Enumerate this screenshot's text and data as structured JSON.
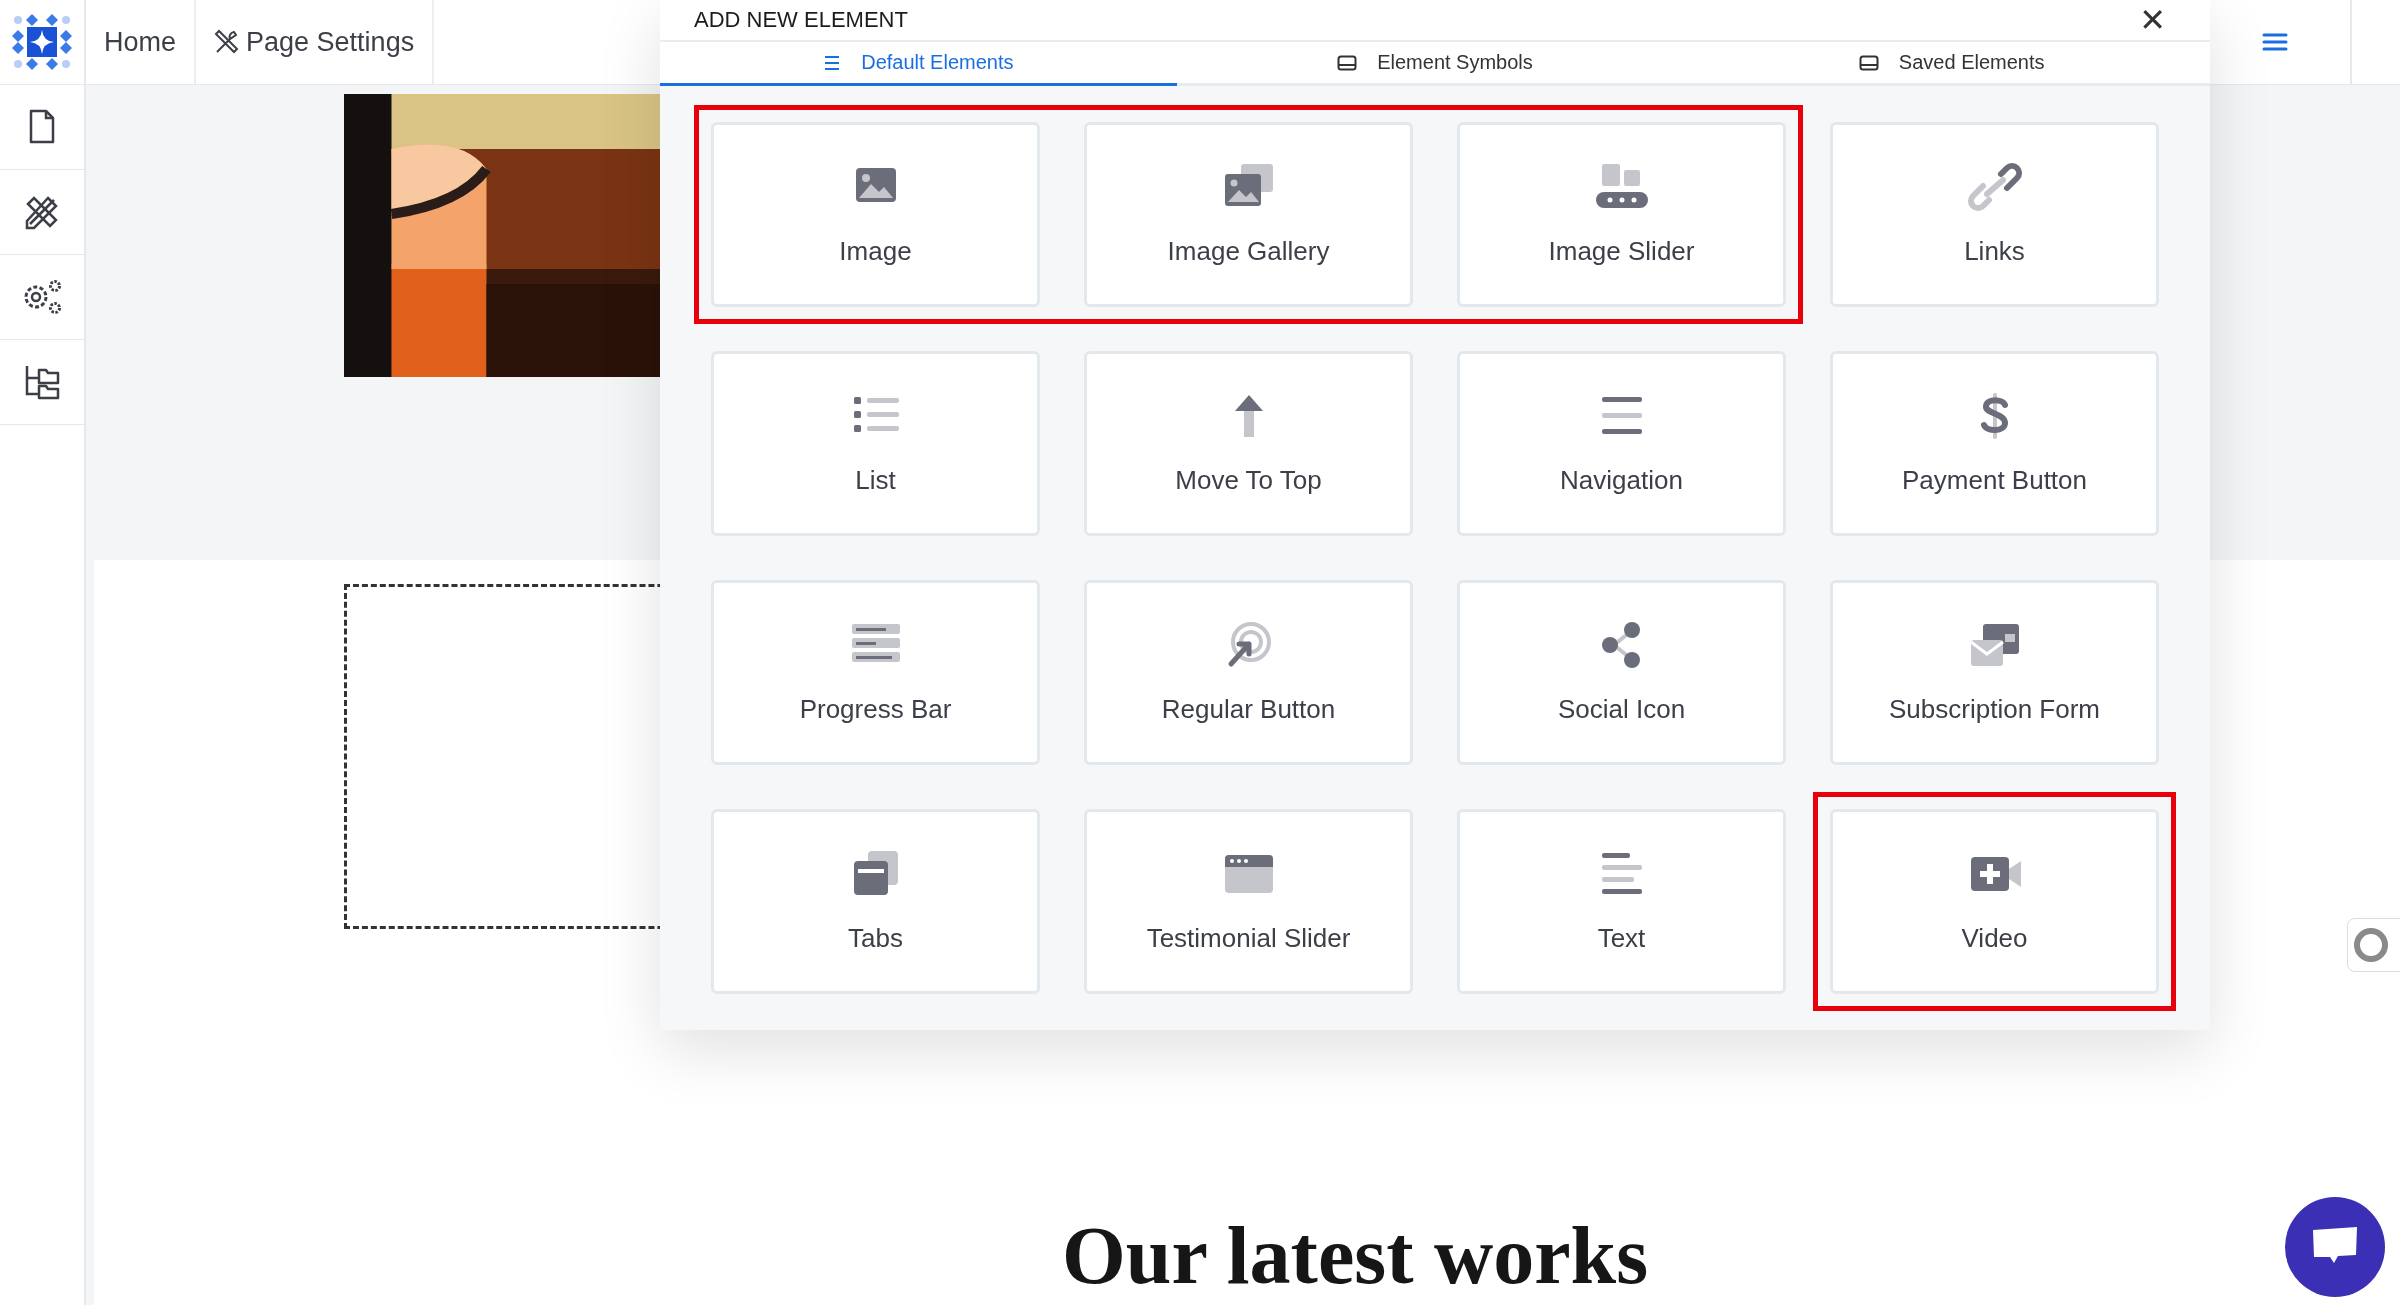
{
  "top_bar": {
    "items": [
      {
        "label": "Home",
        "kind": "plain"
      },
      {
        "label": "Page Settings",
        "kind": "settings"
      }
    ]
  },
  "page": {
    "heading": "Our latest works"
  },
  "modal": {
    "title": "ADD NEW ELEMENT",
    "close": "✕",
    "tabs": [
      {
        "label": "Default Elements",
        "selected": true
      },
      {
        "label": "Element Symbols",
        "selected": false
      },
      {
        "label": "Saved Elements",
        "selected": false
      }
    ],
    "elements": [
      {
        "label": "Image",
        "highlighted": true
      },
      {
        "label": "Image Gallery",
        "highlighted": true
      },
      {
        "label": "Image Slider",
        "highlighted": true
      },
      {
        "label": "Links",
        "highlighted": false
      },
      {
        "label": "List",
        "highlighted": false
      },
      {
        "label": "Move To Top",
        "highlighted": false
      },
      {
        "label": "Navigation",
        "highlighted": false
      },
      {
        "label": "Payment Button",
        "highlighted": false
      },
      {
        "label": "Progress Bar",
        "highlighted": false
      },
      {
        "label": "Regular Button",
        "highlighted": false
      },
      {
        "label": "Social Icon",
        "highlighted": false
      },
      {
        "label": "Subscription Form",
        "highlighted": false
      },
      {
        "label": "Tabs",
        "highlighted": false
      },
      {
        "label": "Testimonial Slider",
        "highlighted": false
      },
      {
        "label": "Text",
        "highlighted": false
      },
      {
        "label": "Video",
        "highlighted": true
      }
    ]
  }
}
